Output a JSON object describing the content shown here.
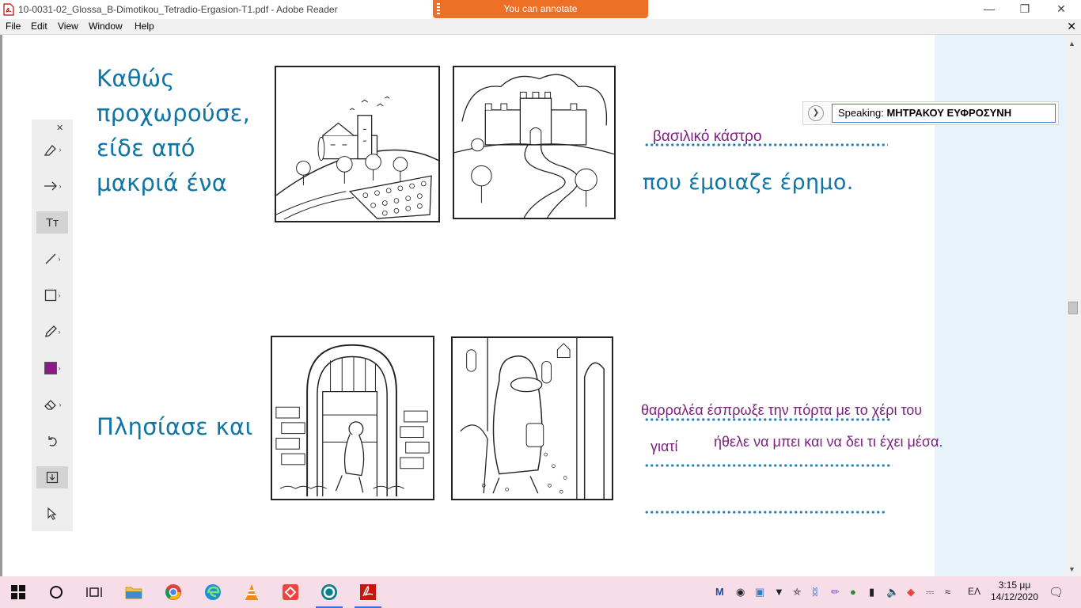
{
  "window": {
    "title": "10-0031-02_Glossa_B-Dimotikou_Tetradio-Ergasion-T1.pdf - Adobe Reader",
    "annotate_banner": "You can annotate",
    "minimize": "—",
    "restore": "❐",
    "close": "✕"
  },
  "menu": {
    "file": "File",
    "edit": "Edit",
    "view": "View",
    "window": "Window",
    "help": "Help",
    "close_doc": "✕"
  },
  "toolbar": {
    "close": "✕",
    "text_tool_glyph": "Tт",
    "active_color": "#8a1a85"
  },
  "page": {
    "row1": {
      "lines": [
        "Καθώς",
        "προχωρούσε,",
        "είδε από",
        "μακριά ένα"
      ],
      "annotation": "βασιλικό κάστρο",
      "continuation": "που έμοιαζε έρημο."
    },
    "row2": {
      "lead": "Πλησίασε και",
      "annotation1": "θαρραλέα έσπρωξε την πόρτα με το χέρι του",
      "annotation2": "γιατί",
      "annotation3": "ήθελε να μπει και να δει τι έχει μέσα."
    }
  },
  "speaking": {
    "label": "Speaking:",
    "name": "ΜΗΤΡΑΚΟΥ ΕΥΦΡΟΣΥΝΗ"
  },
  "taskbar": {
    "language": "ΕΛ",
    "time": "3:15 μμ",
    "date": "14/12/2020"
  },
  "colors": {
    "body_text": "#0f75a6",
    "annotation_text": "#7b1f7f",
    "banner": "#ee7027",
    "side_panel": "#e6f3fb"
  }
}
